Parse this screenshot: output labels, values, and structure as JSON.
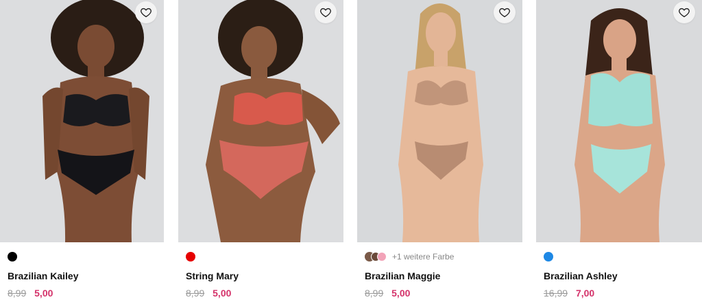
{
  "products": [
    {
      "name": "Brazilian Kailey",
      "old_price": "8,99",
      "new_price": "5,00",
      "swatches": [
        "#000000"
      ],
      "more_colors": "",
      "image_icon": "model-photo",
      "wishlist_icon": "heart-icon"
    },
    {
      "name": "String Mary",
      "old_price": "8,99",
      "new_price": "5,00",
      "swatches": [
        "#e60000"
      ],
      "more_colors": "",
      "image_icon": "model-photo",
      "wishlist_icon": "heart-icon"
    },
    {
      "name": "Brazilian Maggie",
      "old_price": "8,99",
      "new_price": "5,00",
      "swatches": [
        "#7a5a48",
        "#6b4a3a",
        "#f2a3b8"
      ],
      "more_colors": "+1 weitere Farbe",
      "image_icon": "model-photo",
      "wishlist_icon": "heart-icon"
    },
    {
      "name": "Brazilian Ashley",
      "old_price": "16,99",
      "new_price": "7,00",
      "swatches": [
        "#1e88e5"
      ],
      "more_colors": "",
      "image_icon": "model-photo",
      "wishlist_icon": "heart-icon"
    }
  ],
  "colors": {
    "sale_price": "#d4326a",
    "old_price": "#9a9a9a",
    "photo_bg": "#d9dadc",
    "wish_bg": "#f3f3f3"
  }
}
